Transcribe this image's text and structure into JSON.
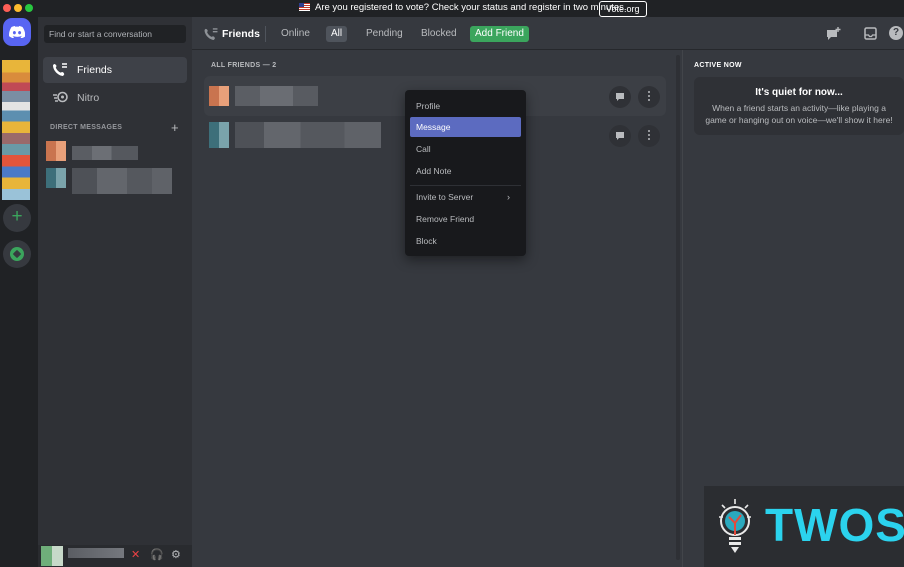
{
  "banner": {
    "text": "Are you registered to vote? Check your status and register in two minutes.",
    "button_label": "Vote.org"
  },
  "sidebar": {
    "search_placeholder": "Find or start a conversation",
    "items": [
      {
        "label": "Friends",
        "icon": "friends-icon"
      },
      {
        "label": "Nitro",
        "icon": "nitro-icon"
      }
    ],
    "dm_header": "DIRECT MESSAGES"
  },
  "header": {
    "title": "Friends",
    "tabs": [
      {
        "label": "Online"
      },
      {
        "label": "All"
      },
      {
        "label": "Pending"
      },
      {
        "label": "Blocked"
      },
      {
        "label": "Add Friend"
      }
    ],
    "selected_tab": "All"
  },
  "friends": {
    "header": "ALL FRIENDS — 2"
  },
  "context_menu": {
    "items": [
      "Profile",
      "Message",
      "Call",
      "Add Note",
      "Invite to Server",
      "Remove Friend",
      "Block"
    ],
    "highlighted": "Message"
  },
  "active_now": {
    "header": "ACTIVE NOW",
    "title": "It's quiet for now...",
    "description": "When a friend starts an activity—like playing a game or hanging out on voice—we'll show it here!"
  },
  "watermark": {
    "text": "TWOS"
  },
  "colors": {
    "accent": "#5865f2",
    "add_friend_green": "#3ba55d",
    "menu_highlight": "#5c6bc0",
    "watermark_cyan": "#2bd3ee"
  }
}
